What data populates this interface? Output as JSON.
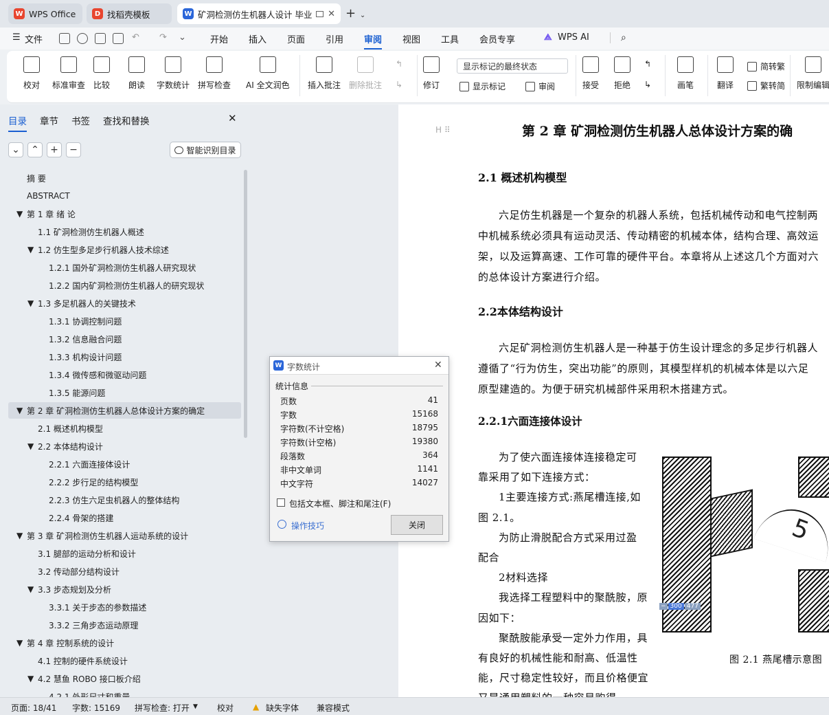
{
  "tabs": [
    {
      "label": "WPS Office",
      "icon": "wps-logo-icon"
    },
    {
      "label": "找稻壳模板",
      "icon": "docer-logo-icon"
    },
    {
      "label": "矿洞检测仿生机器人设计 毕业",
      "icon": "word-doc-icon"
    }
  ],
  "menu": {
    "file": "文件",
    "items": [
      "开始",
      "插入",
      "页面",
      "引用",
      "审阅",
      "视图",
      "工具",
      "会员专享"
    ],
    "active": "审阅",
    "ai": "WPS AI"
  },
  "ribbon": {
    "proofread": "校对",
    "std_review": "标准审查",
    "compare": "比较",
    "read_aloud": "朗读",
    "word_count": "字数统计",
    "spell_check": "拼写检查",
    "ai_proof": "AI 全文润色",
    "insert_comment": "插入批注",
    "delete_comment": "删除批注",
    "track": "修订",
    "markup_select": "显示标记的最终状态",
    "show_markup": "显示标记",
    "review": "审阅",
    "accept": "接受",
    "reject": "拒绝",
    "pen": "画笔",
    "translate": "翻译",
    "trad": "简转繁",
    "simp": "繁转简",
    "restrict": "限制编辑"
  },
  "panel": {
    "tabs": [
      "目录",
      "章节",
      "书签",
      "查找和替换"
    ],
    "smart_toc": "智能识别目录",
    "toc": [
      {
        "t": "摘 要",
        "l": 0
      },
      {
        "t": "ABSTRACT",
        "l": 0
      },
      {
        "t": "第 1 章 绪 论",
        "l": 0,
        "c": true
      },
      {
        "t": "1.1 矿洞检测仿生机器人概述",
        "l": 1
      },
      {
        "t": "1.2 仿生型多足步行机器人技术综述",
        "l": 1,
        "c": true
      },
      {
        "t": "1.2.1 国外矿洞检测仿生机器人研究现状",
        "l": 2
      },
      {
        "t": "1.2.2 国内矿洞检测仿生机器人的研究现状",
        "l": 2
      },
      {
        "t": "1.3 多足机器人的关键技术",
        "l": 1,
        "c": true
      },
      {
        "t": "1.3.1 协调控制问题",
        "l": 2
      },
      {
        "t": "1.3.2 信息融合问题",
        "l": 2
      },
      {
        "t": "1.3.3 机构设计问题",
        "l": 2
      },
      {
        "t": "1.3.4 微传感和微驱动问题",
        "l": 2
      },
      {
        "t": "1.3.5 能源问题",
        "l": 2
      },
      {
        "t": "第 2 章  矿洞检测仿生机器人总体设计方案的确定",
        "l": 0,
        "c": true
      },
      {
        "t": "2.1 概述机构模型",
        "l": 1
      },
      {
        "t": "2.2 本体结构设计",
        "l": 1,
        "c": true
      },
      {
        "t": "2.2.1 六面连接体设计",
        "l": 2
      },
      {
        "t": "2.2.2 步行足的结构模型",
        "l": 2
      },
      {
        "t": "2.2.3 仿生六足虫机器人的整体结构",
        "l": 2
      },
      {
        "t": "2.2.4 骨架的搭建",
        "l": 2
      },
      {
        "t": "第 3 章  矿洞检测仿生机器人运动系统的设计",
        "l": 0,
        "c": true
      },
      {
        "t": "3.1 腿部的运动分析和设计",
        "l": 1
      },
      {
        "t": "3.2 传动部分结构设计",
        "l": 1
      },
      {
        "t": "3.3 步态规划及分析",
        "l": 1,
        "c": true
      },
      {
        "t": "3.3.1 关于步态的参数描述",
        "l": 2
      },
      {
        "t": "3.3.2  三角步态运动原理",
        "l": 2
      },
      {
        "t": "第 4 章  控制系统的设计",
        "l": 0,
        "c": true
      },
      {
        "t": "4.1 控制的硬件系统设计",
        "l": 1
      },
      {
        "t": "4.2 慧鱼  ROBO 接口板介绍",
        "l": 1,
        "c": true
      },
      {
        "t": "4.2.1 外形尺寸和重量",
        "l": 2
      }
    ]
  },
  "document": {
    "chapter_title": "第 2 章   矿洞检测仿生机器人总体设计方案的确",
    "h21": "2.1  概述机构模型",
    "p1": [
      "六足仿生机器是一个复杂的机器人系统，包括机械传动和电气控制两",
      "中机械系统必须具有运动灵活、传动精密的机械本体，结构合理、高效运",
      "架，以及运算高速、工作可靠的硬件平台。本章将从上述这几个方面对六",
      "的总体设计方案进行介绍。"
    ],
    "h22": "2.2本体结构设计",
    "p2": [
      "六足矿洞检测仿生机器人是一种基于仿生设计理念的多足步行机器人",
      "遵循了“行为仿生，突出功能”的原则，其模型样机的机械本体是以六足",
      "原型建造的。为便于研究机械部件采用积木搭建方式。"
    ],
    "h221": "2.2.1六面连接体设计",
    "p3": [
      "为了使六面连接体连接稳定可",
      "靠采用了如下连接方式：",
      "1主要连接方式:燕尾槽连接,如",
      "图 2.1。",
      "为防止滑脱配合方式采用过盈",
      "配合",
      "2材料选择",
      "我选择工程塑料中的聚酰胺，原",
      "因如下：",
      "聚酰胺能承受一定外力作用，具",
      "有良好的机械性能和耐高、低温性",
      "能，尺寸稳定性较好，而且价格便宜",
      "又是通用塑料的一种容易购得"
    ],
    "fig_caption": "图 2.1  燕尾槽示意图",
    "fig_label": "5",
    "mini_a": "300",
    "mini_b": "477"
  },
  "dialog": {
    "title": "字数统计",
    "section": "统计信息",
    "rows": [
      {
        "k": "页数",
        "v": "41"
      },
      {
        "k": "字数",
        "v": "15168"
      },
      {
        "k": "字符数(不计空格)",
        "v": "18795"
      },
      {
        "k": "字符数(计空格)",
        "v": "19380"
      },
      {
        "k": "段落数",
        "v": "364"
      },
      {
        "k": "非中文单词",
        "v": "1141"
      },
      {
        "k": "中文字符",
        "v": "14027"
      }
    ],
    "checkbox": "包括文本框、脚注和尾注(F)",
    "tips": "操作技巧",
    "close": "关闭"
  },
  "status": {
    "page": "页面: 18/41",
    "words": "字数: 15169",
    "spell": "拼写检查: 打开",
    "proof": "校对",
    "missing_font": "缺失字体",
    "compat": "兼容模式"
  }
}
